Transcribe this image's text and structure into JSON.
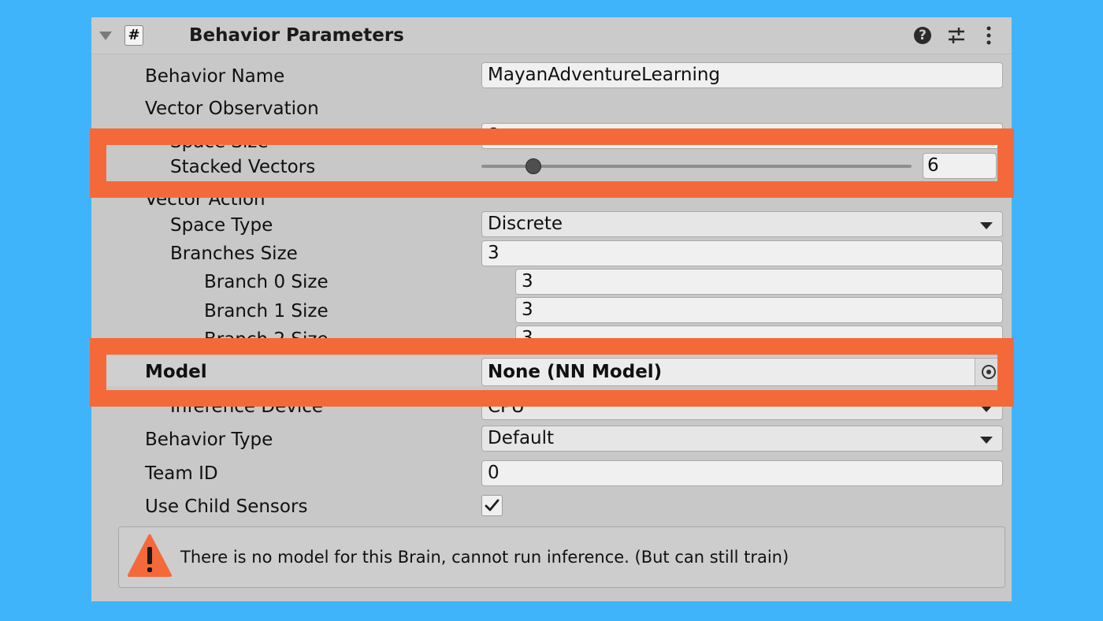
{
  "component": {
    "title": "Behavior Parameters",
    "script_glyph": "#",
    "icons": [
      "collapse-triangle-icon",
      "script-hash-icon",
      "help-icon",
      "preset-sliders-icon",
      "kebab-menu-icon"
    ]
  },
  "rows": {
    "behavior_name": {
      "label": "Behavior Name",
      "value": "MayanAdventureLearning"
    },
    "vector_observation": {
      "label": "Vector Observation"
    },
    "space_size": {
      "label": "Space Size",
      "value": "8"
    },
    "stacked_vectors": {
      "label": "Stacked Vectors",
      "value": "6",
      "slider_fraction": 0.12
    },
    "vector_action": {
      "label": "Vector Action"
    },
    "space_type": {
      "label": "Space Type",
      "value": "Discrete"
    },
    "branches_size": {
      "label": "Branches Size",
      "value": "3"
    },
    "branch0": {
      "label": "Branch 0 Size",
      "value": "3"
    },
    "branch1": {
      "label": "Branch 1 Size",
      "value": "3"
    },
    "branch2": {
      "label": "Branch 2 Size",
      "value": "3"
    },
    "model": {
      "label": "Model",
      "value": "None (NN Model)"
    },
    "inference_device": {
      "label": "Inference Device",
      "value": "CPU"
    },
    "behavior_type": {
      "label": "Behavior Type",
      "value": "Default"
    },
    "team_id": {
      "label": "Team ID",
      "value": "0"
    },
    "use_child_sensors": {
      "label": "Use Child Sensors",
      "checked": true
    }
  },
  "warning": {
    "text": "There is no model for this Brain, cannot run inference. (But can still train)"
  },
  "colors": {
    "background": "#3fb4fb",
    "panel": "#c8c8c8",
    "highlight": "#f4693a",
    "warning_icon": "#f4693a"
  }
}
